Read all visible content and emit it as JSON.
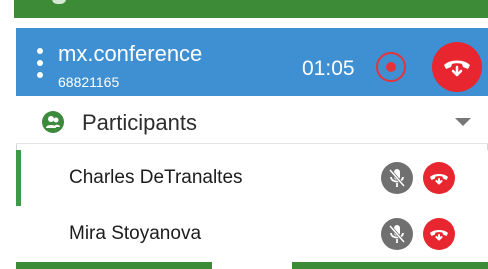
{
  "call": {
    "name": "mx.conference",
    "number": "68821165",
    "timer": "01:05",
    "icons": {
      "menu": "kebab-icon",
      "record": "record-icon",
      "hangup": "hangup-icon"
    }
  },
  "participants": {
    "label": "Participants",
    "icon": "group-icon",
    "toggle_icon": "chevron-down-icon",
    "items": [
      {
        "name": "Charles DeTranaltes"
      },
      {
        "name": "Mira Stoyanova"
      }
    ]
  },
  "colors": {
    "header_blue": "#3e90d2",
    "hangup_red": "#e8262f",
    "accent_green": "#3d8b37",
    "mute_gray": "#707070"
  }
}
